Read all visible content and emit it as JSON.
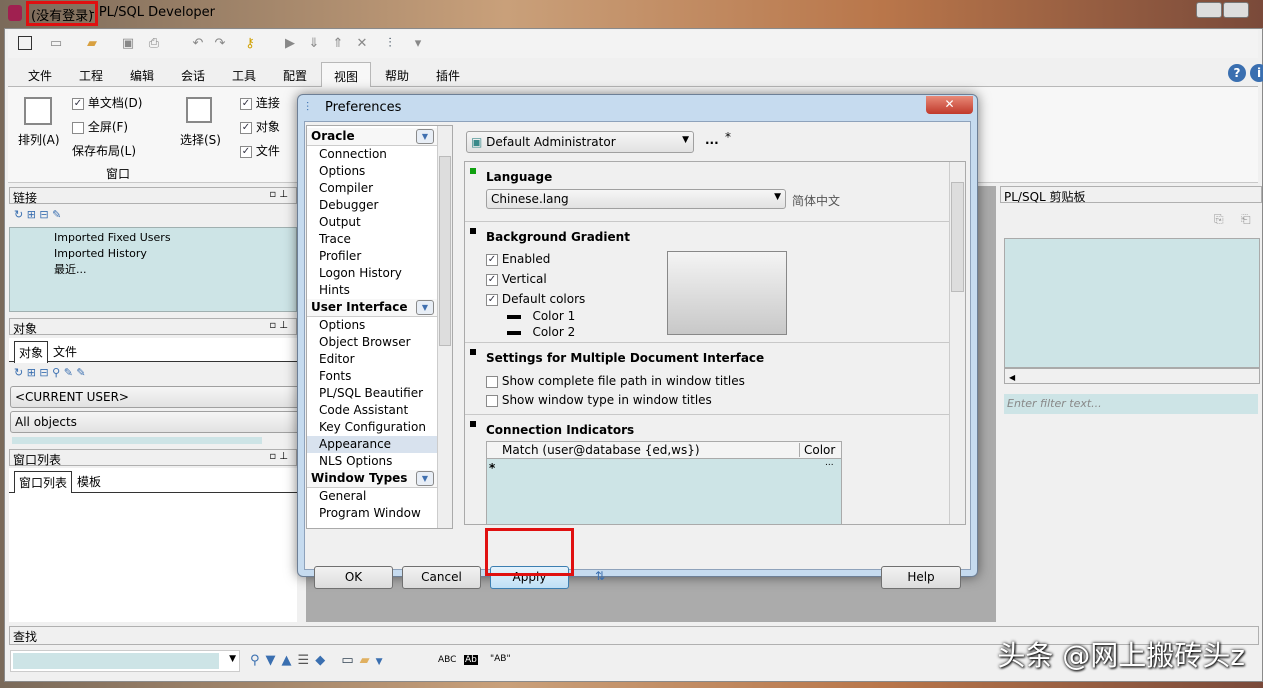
{
  "window": {
    "title_status": "(没有登录)",
    "title_app": " - PL/SQL Developer"
  },
  "menu": [
    "文件",
    "工程",
    "编辑",
    "会话",
    "工具",
    "配置",
    "视图",
    "帮助",
    "插件"
  ],
  "menu_active": "视图",
  "ribbon": {
    "arrange": "排列(A)",
    "single_doc": "单文档(D)",
    "fullscreen": "全屏(F)",
    "save_layout": "保存布局(L)",
    "select": "选择(S)",
    "group_window": "窗口",
    "conn": "连接",
    "obj": "对象",
    "file": "文件",
    "single_doc_checked": true,
    "fullscreen_checked": false
  },
  "connections": {
    "title": "链接",
    "items": [
      "Imported Fixed Users",
      "Imported History",
      "最近..."
    ]
  },
  "objects": {
    "title": "对象",
    "tabs": [
      "对象",
      "文件"
    ],
    "user": "<CURRENT USER>",
    "filter": "All objects"
  },
  "windowlist": {
    "title": "窗口列表",
    "tabs": [
      "窗口列表",
      "模板"
    ]
  },
  "clipboard": {
    "title": "PL/SQL 剪贴板",
    "filter_placeholder": "Enter filter text..."
  },
  "find": {
    "title": "查找",
    "tools": [
      "ABC",
      "Ab",
      "\"AB\""
    ]
  },
  "dialog": {
    "title": "Preferences",
    "groups": [
      {
        "name": "Oracle",
        "items": [
          "Connection",
          "Options",
          "Compiler",
          "Debugger",
          "Output",
          "Trace",
          "Profiler",
          "Logon History",
          "Hints"
        ]
      },
      {
        "name": "User Interface",
        "items": [
          "Options",
          "Object Browser",
          "Editor",
          "Fonts",
          "PL/SQL Beautifier",
          "Code Assistant",
          "Key Configuration",
          "Appearance",
          "NLS Options"
        ]
      },
      {
        "name": "Window Types",
        "items": [
          "General",
          "Program Window"
        ]
      }
    ],
    "selected_item": "Appearance",
    "profile": "Default Administrator",
    "profile_more": "...",
    "profile_modified": "*",
    "language": {
      "title": "Language",
      "value": "Chinese.lang",
      "display": "简体中文"
    },
    "gradient": {
      "title": "Background Gradient",
      "enabled": "Enabled",
      "vertical": "Vertical",
      "default_colors": "Default colors",
      "color1": "Color 1",
      "color2": "Color 2"
    },
    "mdi": {
      "title": "Settings for Multiple Document Interface",
      "opt1": "Show complete file path in window titles",
      "opt2": "Show window type in window titles"
    },
    "indicators": {
      "title": "Connection Indicators",
      "col_match": "Match (user@database {ed,ws})",
      "col_color": "Color",
      "new_row": "*",
      "ellipsis": "..."
    },
    "buttons": {
      "ok": "OK",
      "cancel": "Cancel",
      "apply": "Apply",
      "help": "Help"
    }
  },
  "watermark": "头条 @网上搬砖头z",
  "colors": {
    "teal": "#cde4e6",
    "highlight": "#e01010",
    "accent": "#3a6fb0"
  }
}
